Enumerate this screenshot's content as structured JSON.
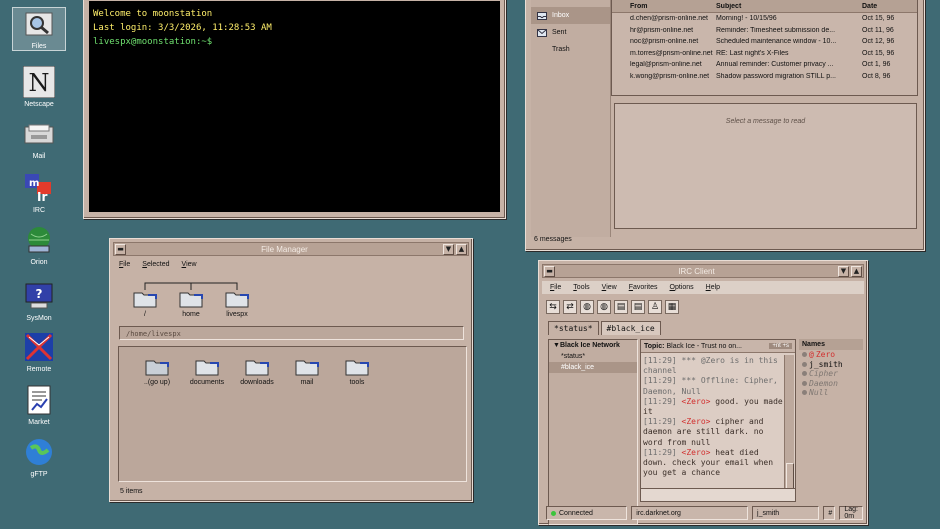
{
  "desktop_icons": [
    {
      "label": "Files",
      "icon": "files-icon"
    },
    {
      "label": "Netscape",
      "icon": "netscape-icon"
    },
    {
      "label": "Mail",
      "icon": "mail-icon"
    },
    {
      "label": "IRC",
      "icon": "irc-icon"
    },
    {
      "label": "Orion",
      "icon": "orion-icon"
    },
    {
      "label": "SysMon",
      "icon": "sysmon-icon"
    },
    {
      "label": "Remote",
      "icon": "remote-icon"
    },
    {
      "label": "Market",
      "icon": "market-icon"
    },
    {
      "label": "gFTP",
      "icon": "gftp-icon"
    }
  ],
  "terminal": {
    "line1": "Welcome to moonstation",
    "line2": "Last login: 3/3/2026, 11:28:53 AM",
    "prompt": "livespx@moonstation:~$"
  },
  "mail": {
    "folders": [
      "Inbox",
      "Sent",
      "Trash"
    ],
    "columns": {
      "from": "From",
      "subject": "Subject",
      "date": "Date"
    },
    "messages": [
      {
        "from": "d.chen@prism-online.net",
        "subject": "Morning! - 10/15/96",
        "date": "Oct 15, 96"
      },
      {
        "from": "hr@prism-online.net",
        "subject": "Reminder: Timesheet submission de...",
        "date": "Oct 11, 96"
      },
      {
        "from": "noc@prism-online.net",
        "subject": "Scheduled maintenance window - 10...",
        "date": "Oct 12, 96"
      },
      {
        "from": "m.torres@prism-online.net",
        "subject": "RE: Last night's X-Files",
        "date": "Oct 15, 96"
      },
      {
        "from": "legal@prism-online.net",
        "subject": "Annual reminder: Customer privacy ...",
        "date": "Oct 1, 96"
      },
      {
        "from": "k.wong@prism-online.net",
        "subject": "Shadow password migration STILL p...",
        "date": "Oct 8, 96"
      }
    ],
    "preview_placeholder": "Select a message to read",
    "status": "6 messages"
  },
  "file_manager": {
    "title": "File Manager",
    "menu": [
      "File",
      "Selected",
      "View"
    ],
    "tree": [
      "/",
      "home",
      "livespx"
    ],
    "path": "/home/livespx",
    "items": [
      "..(go up)",
      "documents",
      "downloads",
      "mail",
      "tools"
    ],
    "status": "5 items"
  },
  "irc": {
    "title": "IRC Client",
    "menu": [
      "File",
      "Tools",
      "View",
      "Favorites",
      "Options",
      "Help"
    ],
    "tabs": [
      "*status*",
      "#black_ice"
    ],
    "network": "Black Ice Network",
    "channels": [
      "*status*",
      "#black_ice"
    ],
    "topic_label": "Topic:",
    "topic": "Black Ice - Trust no on...",
    "topic_mode": "+nt +s",
    "messages": [
      {
        "ts": "[11:29]",
        "text": "*** @Zero is in this channel",
        "kind": "sys"
      },
      {
        "ts": "[11:29]",
        "text": "*** Offline: Cipher, Daemon, Null",
        "kind": "sys"
      },
      {
        "ts": "[11:29]",
        "nick": "<Zero>",
        "text": "good. you made it",
        "kind": "msg"
      },
      {
        "ts": "[11:29]",
        "nick": "<Zero>",
        "text": "cipher and daemon are still dark. no word from null",
        "kind": "msg"
      },
      {
        "ts": "[11:29]",
        "nick": "<Zero>",
        "text": "heat died down. check your email when you get a chance",
        "kind": "msg"
      }
    ],
    "names_header": "Names",
    "names": [
      {
        "name": "Zero",
        "prefix": "@",
        "status": "online",
        "color": "#d1302f"
      },
      {
        "name": "j_smith",
        "prefix": "",
        "status": "online",
        "color": "#111111"
      },
      {
        "name": "Cipher",
        "prefix": "",
        "status": "offline",
        "color": "#7f7772"
      },
      {
        "name": "Daemon",
        "prefix": "",
        "status": "offline",
        "color": "#7f7772"
      },
      {
        "name": "Null",
        "prefix": "",
        "status": "offline",
        "color": "#7f7772"
      }
    ],
    "status": {
      "connection": "Connected",
      "server": "irc.darknet.org",
      "nick": "j_smith",
      "channel": "#",
      "lag": "Lag: 0m"
    }
  },
  "colors": {
    "desktop": "#3f6a74",
    "window": "#c6b2a6",
    "nick": "#d1302f",
    "connected": "#3cc43c"
  }
}
